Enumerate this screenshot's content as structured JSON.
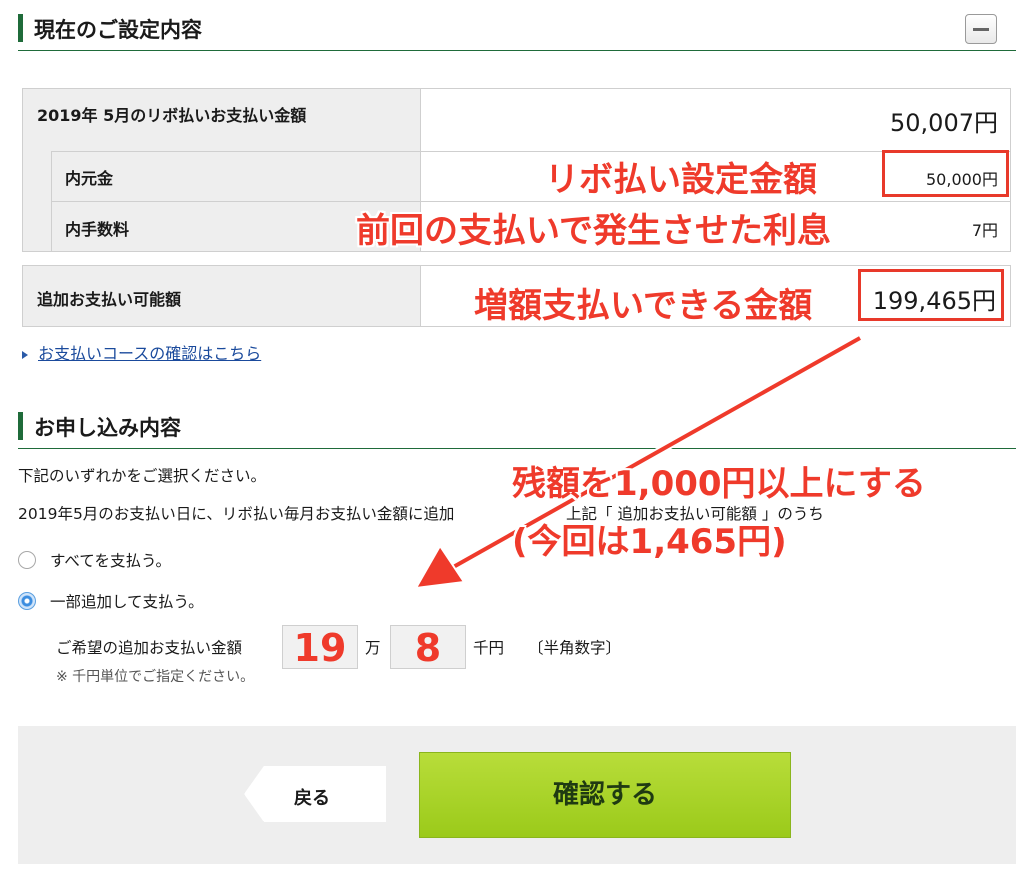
{
  "section1": {
    "title": "現在のご設定内容"
  },
  "table1": {
    "row_main": {
      "label": "2019年 5月のリボ払いお支払い金額",
      "value": "50,007円"
    },
    "row_principal": {
      "label": "内元金",
      "value": "50,000円"
    },
    "row_fee": {
      "label": "内手数料",
      "value": "7円"
    }
  },
  "table2": {
    "label": "追加お支払い可能額",
    "value": "199,465円"
  },
  "annotations": {
    "revo_amount": "リボ払い設定金額",
    "prev_interest": "前回の支払いで発生させた利息",
    "increase_amount": "増額支払いできる金額",
    "remain_line1": "残額を1,000円以上にする",
    "remain_line2": "(今回は1,465円)"
  },
  "link": {
    "label": "お支払いコースの確認はこちら"
  },
  "section2": {
    "title": "お申し込み内容",
    "instruction": "下記のいずれかをご選択ください。",
    "description_visible": "2019年5月のお支払い日に、リボ払い毎月お支払い金額に追加",
    "description_tail": "上記「 追加お支払い可能額 」のうち",
    "option_all": "すべてを支払う。",
    "option_partial": "一部追加して支払う。",
    "amount_label": "ご希望の追加お支払い金額",
    "man_value": "19",
    "man_unit": "万",
    "sen_value": "8",
    "sen_unit": "千円",
    "hint": "〔半角数字〕",
    "note": "※ 千円単位でご指定ください。"
  },
  "footer": {
    "back_label": "戻る",
    "confirm_label": "確認する"
  },
  "colors": {
    "green": "#1f6b3a",
    "annotation_red": "#ef3a2b",
    "confirm_green": "#9bca1a"
  }
}
